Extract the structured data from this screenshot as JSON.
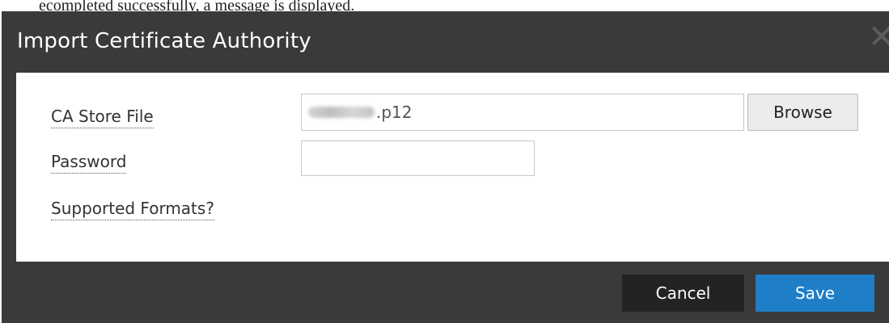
{
  "backdrop": {
    "partial_text": "ecompleted successfully, a message is displayed."
  },
  "dialog": {
    "title": "Import Certificate Authority",
    "close_icon": "close-icon",
    "fields": {
      "ca_store_file": {
        "label": "CA Store File",
        "value": "p12",
        "blurred_prefix": true
      },
      "password": {
        "label": "Password",
        "value": ""
      }
    },
    "browse_label": "Browse",
    "supported_formats_label": "Supported Formats?",
    "buttons": {
      "cancel": "Cancel",
      "save": "Save"
    }
  },
  "colors": {
    "dialog_bg": "#3a3a3a",
    "save_button": "#1e7ec8",
    "cancel_button": "#232323"
  }
}
